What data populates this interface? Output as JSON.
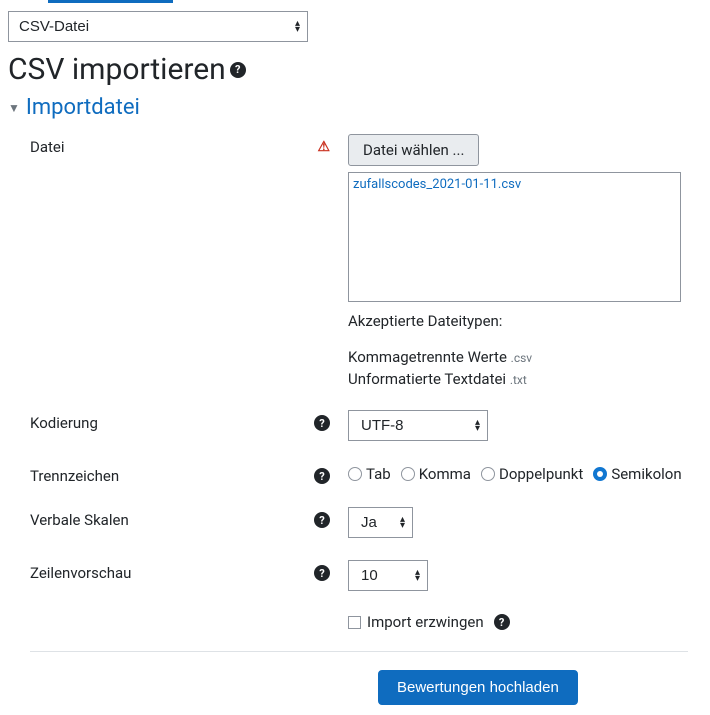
{
  "top_select": {
    "value": "CSV-Datei"
  },
  "page_title": "CSV importieren",
  "section_title": "Importdatei",
  "fields": {
    "file": {
      "label": "Datei",
      "button": "Datei wählen ...",
      "uploaded_filename": "zufallscodes_2021-01-11.csv",
      "accepted_label": "Akzeptierte Dateitypen:",
      "accepted_types": [
        {
          "name": "Kommagetrennte Werte",
          "ext": ".csv"
        },
        {
          "name": "Unformatierte Textdatei",
          "ext": ".txt"
        }
      ]
    },
    "encoding": {
      "label": "Kodierung",
      "value": "UTF-8"
    },
    "separator": {
      "label": "Trennzeichen",
      "options": [
        "Tab",
        "Komma",
        "Doppelpunkt",
        "Semikolon"
      ],
      "selected": "Semikolon"
    },
    "verbalscales": {
      "label": "Verbale Skalen",
      "value": "Ja"
    },
    "preview": {
      "label": "Zeilenvorschau",
      "value": "10"
    },
    "forceimport": {
      "label": "Import erzwingen",
      "checked": false
    }
  },
  "submit_label": "Bewertungen hochladen"
}
